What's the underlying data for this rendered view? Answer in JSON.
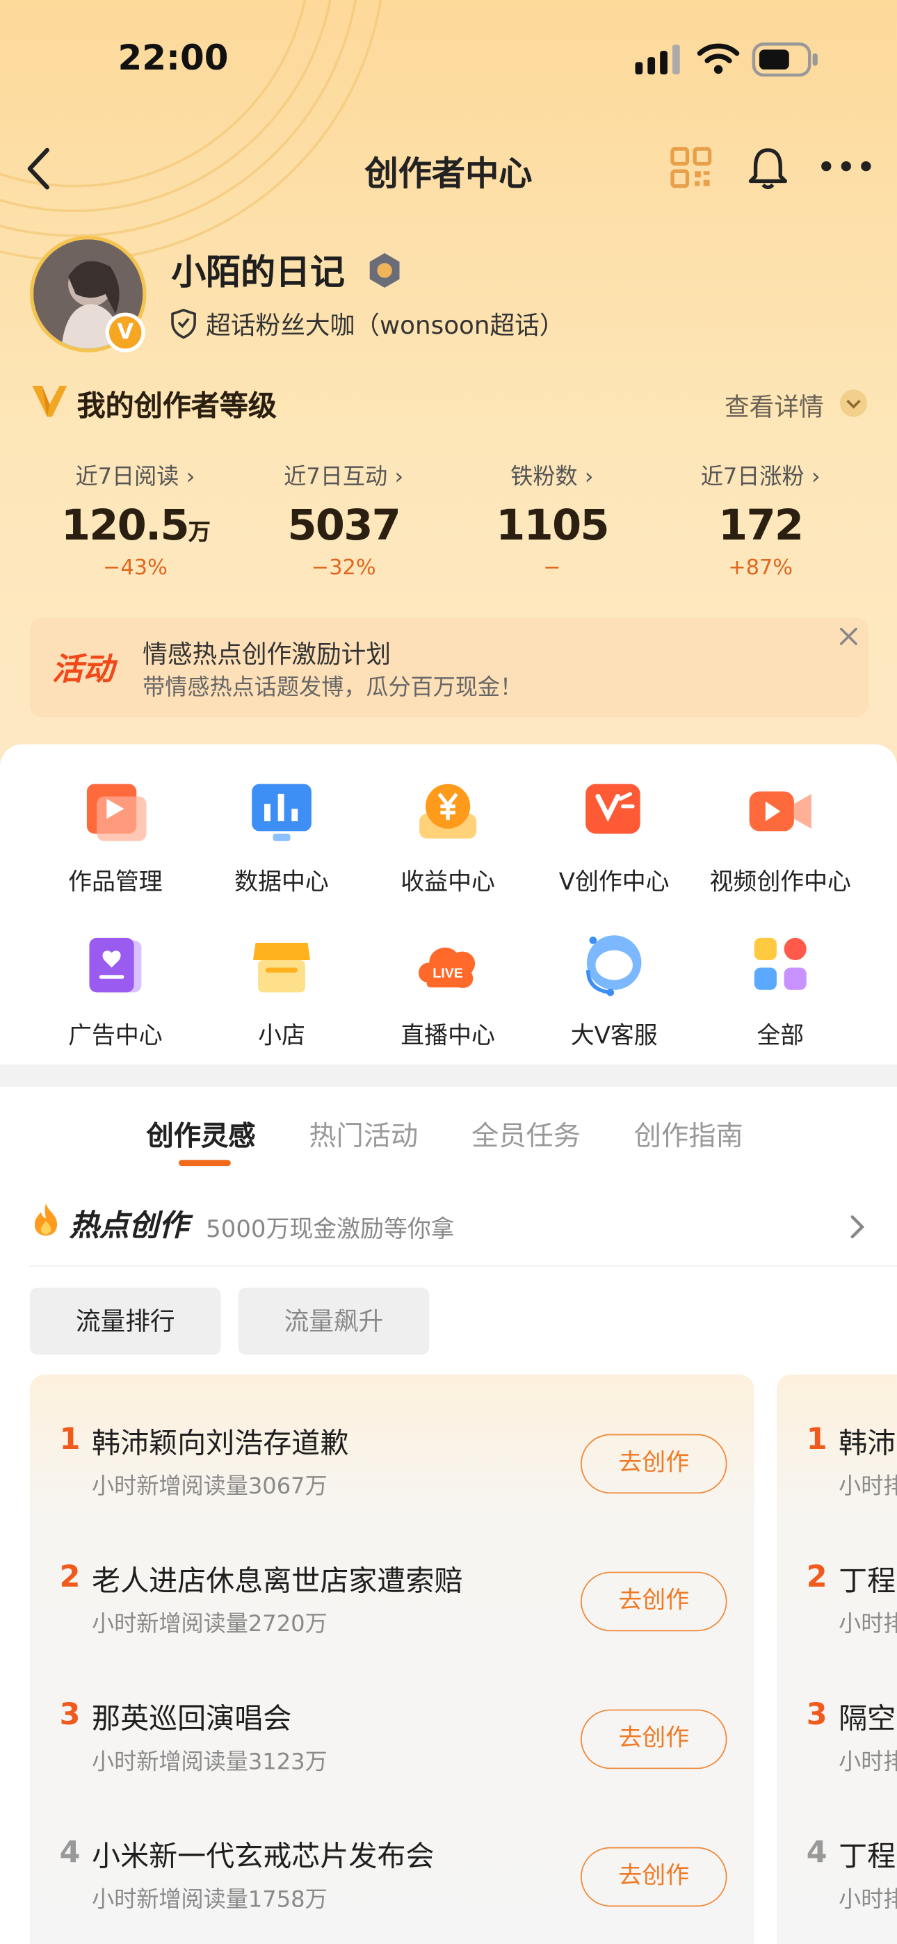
{
  "status": {
    "time": "22:00"
  },
  "nav": {
    "title": "创作者中心"
  },
  "profile": {
    "name": "小陌的日记",
    "subtitle": "超话粉丝大咖（wonsoon超话）",
    "badge": "V"
  },
  "level": {
    "title": "我的创作者等级",
    "detail_link": "查看详情"
  },
  "stats": [
    {
      "label": "近7日阅读 ›",
      "value": "120.5",
      "unit": "万",
      "change": "−43%"
    },
    {
      "label": "近7日互动 ›",
      "value": "5037",
      "unit": "",
      "change": "−32%"
    },
    {
      "label": "铁粉数 ›",
      "value": "1105",
      "unit": "",
      "change": "−"
    },
    {
      "label": "近7日涨粉 ›",
      "value": "172",
      "unit": "",
      "change": "+87%"
    }
  ],
  "activity": {
    "tag": "活动",
    "title": "情感热点创作激励计划",
    "subtitle": "带情感热点话题发博，瓜分百万现金！"
  },
  "tools": [
    {
      "label": "作品管理",
      "icon": "play-folder-icon"
    },
    {
      "label": "数据中心",
      "icon": "bar-chart-icon"
    },
    {
      "label": "收益中心",
      "icon": "yen-coin-icon"
    },
    {
      "label": "V创作中心",
      "icon": "v-creation-icon"
    },
    {
      "label": "视频创作中心",
      "icon": "video-camera-icon"
    },
    {
      "label": "广告中心",
      "icon": "ad-book-icon"
    },
    {
      "label": "小店",
      "icon": "shop-icon"
    },
    {
      "label": "直播中心",
      "icon": "live-icon"
    },
    {
      "label": "大V客服",
      "icon": "headset-robot-icon"
    },
    {
      "label": "全部",
      "icon": "all-grid-icon"
    }
  ],
  "tabs": [
    {
      "label": "创作灵感",
      "active": true
    },
    {
      "label": "热门活动",
      "active": false
    },
    {
      "label": "全员任务",
      "active": false
    },
    {
      "label": "创作指南",
      "active": false
    }
  ],
  "hot": {
    "title": "热点创作",
    "subtitle": "5000万现金激励等你拿"
  },
  "chips": [
    {
      "label": "流量排行",
      "active": true
    },
    {
      "label": "流量飙升",
      "active": false
    }
  ],
  "ranking": [
    {
      "rank": "1",
      "title": "韩沛颖向刘浩存道歉",
      "sub": "小时新增阅读量3067万",
      "button": "去创作"
    },
    {
      "rank": "2",
      "title": "老人进店休息离世店家遭索赔",
      "sub": "小时新增阅读量2720万",
      "button": "去创作"
    },
    {
      "rank": "3",
      "title": "那英巡回演唱会",
      "sub": "小时新增阅读量3123万",
      "button": "去创作"
    },
    {
      "rank": "4",
      "title": "小米新一代玄戒芯片发布会",
      "sub": "小时新增阅读量1758万",
      "button": "去创作"
    }
  ],
  "ranking2": [
    {
      "rank": "1",
      "title": "韩沛",
      "sub": "小时排"
    },
    {
      "rank": "2",
      "title": "丁程",
      "sub": "小时排"
    },
    {
      "rank": "3",
      "title": "隔空",
      "sub": "小时排"
    },
    {
      "rank": "4",
      "title": "丁程",
      "sub": "小时排"
    }
  ],
  "colors": {
    "accent": "#f26a1b",
    "rank_top": "#f05a1c",
    "rank_other": "#999999",
    "header_bg": "#fdd99a"
  }
}
